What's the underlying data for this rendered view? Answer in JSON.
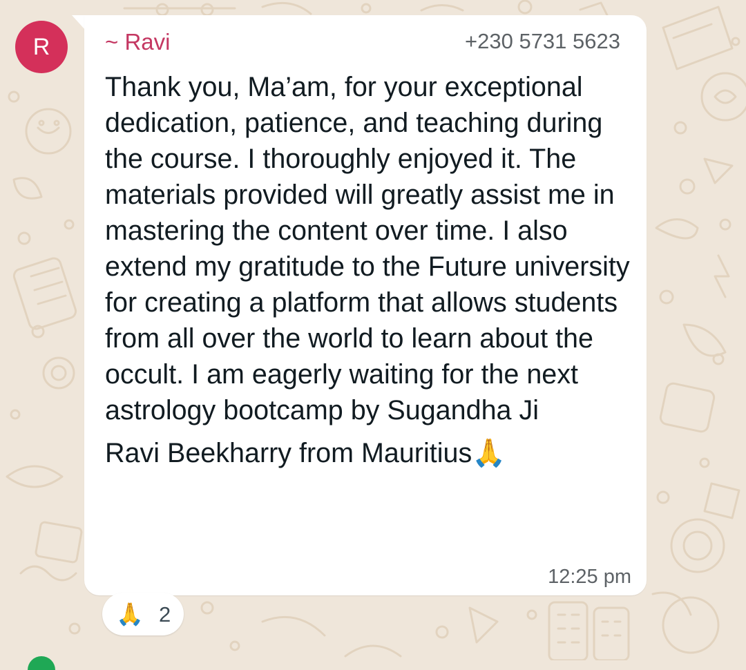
{
  "colors": {
    "wallpaper": "#efe6da",
    "doodle": "#e2d3bf",
    "bubble": "#ffffff",
    "avatar": "#d4305a",
    "sender_name": "#c43762",
    "meta_text": "#5d6266",
    "message_text": "#111b21",
    "next_avatar": "#1fa855"
  },
  "avatar": {
    "initial": "R"
  },
  "message": {
    "sender_name": "~ Ravi",
    "sender_phone": "+230 5731 5623",
    "body": "Thank you, Ma’am, for your exceptional dedication, patience, and teaching during the course. I thoroughly enjoyed it. The materials provided will greatly assist me in mastering the content over time. I also extend my gratitude to the Future university for creating a platform that allows students from all over the world to learn about the occult. I am eagerly waiting for the next astrology bootcamp by Sugandha Ji",
    "signature": "Ravi Beekharry from Mauritius",
    "signature_emoji": "🙏",
    "time": "12:25 pm"
  },
  "reaction": {
    "emoji": "🙏",
    "count": "2"
  },
  "icons": {
    "signature_emoji": "folded-hands-icon",
    "reaction_emoji": "folded-hands-icon"
  }
}
